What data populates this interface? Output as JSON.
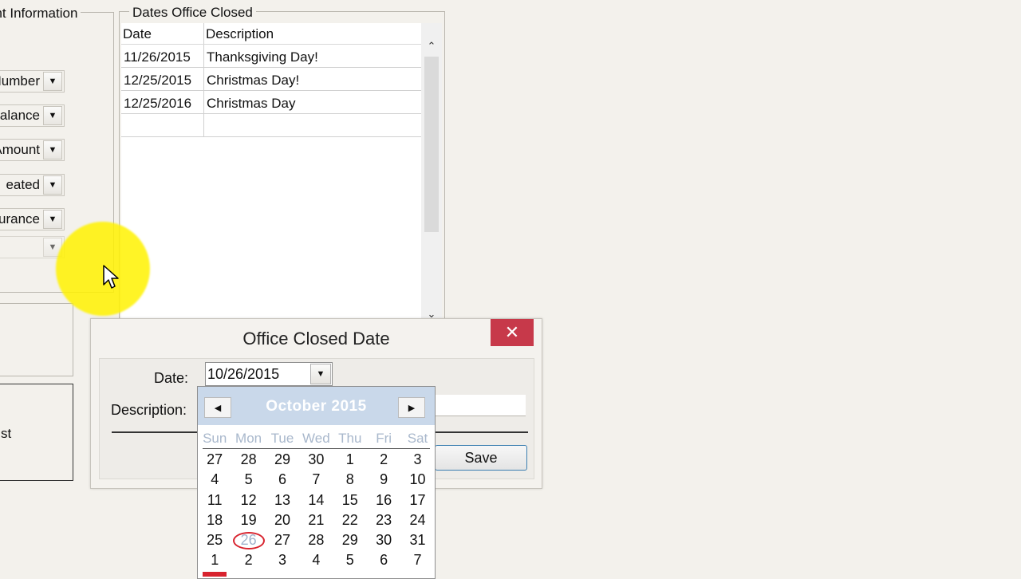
{
  "left_group": {
    "legend": "ent Information",
    "combos": [
      "Number",
      "p Balance",
      "Amount",
      "eated",
      "surance",
      ""
    ]
  },
  "dates_group": {
    "legend": "Dates Office Closed",
    "columns": [
      "Date",
      "Description"
    ],
    "rows": [
      {
        "date": "11/26/2015",
        "description": "Thanksgiving Day!"
      },
      {
        "date": "12/25/2015",
        "description": "Christmas Day!"
      },
      {
        "date": "12/25/2016",
        "description": "Christmas Day"
      },
      {
        "date": "",
        "description": ""
      }
    ]
  },
  "left_box2_text": "st",
  "dialog": {
    "title": "Office Closed Date",
    "close_glyph": "✕",
    "date_label": "Date:",
    "date_value": "10/26/2015",
    "description_label": "Description:",
    "save_label": "Save"
  },
  "calendar": {
    "month_label": "October 2015",
    "prev_glyph": "◀",
    "next_glyph": "▶",
    "weekdays": [
      "Sun",
      "Mon",
      "Tue",
      "Wed",
      "Thu",
      "Fri",
      "Sat"
    ],
    "weeks": [
      [
        "27",
        "28",
        "29",
        "30",
        "1",
        "2",
        "3"
      ],
      [
        "4",
        "5",
        "6",
        "7",
        "8",
        "9",
        "10"
      ],
      [
        "11",
        "12",
        "13",
        "14",
        "15",
        "16",
        "17"
      ],
      [
        "18",
        "19",
        "20",
        "21",
        "22",
        "23",
        "24"
      ],
      [
        "25",
        "26",
        "27",
        "28",
        "29",
        "30",
        "31"
      ],
      [
        "1",
        "2",
        "3",
        "4",
        "5",
        "6",
        "7"
      ]
    ],
    "selected_day": "26"
  },
  "icons": {
    "dropdown_arrow": "▼",
    "scroll_up": "⌃",
    "scroll_down": "⌄"
  },
  "colors": {
    "close_red": "#c7394a",
    "calendar_header": "#c9d8ea",
    "today_circle": "#d8232e",
    "cursor_highlight": "#fff200"
  }
}
